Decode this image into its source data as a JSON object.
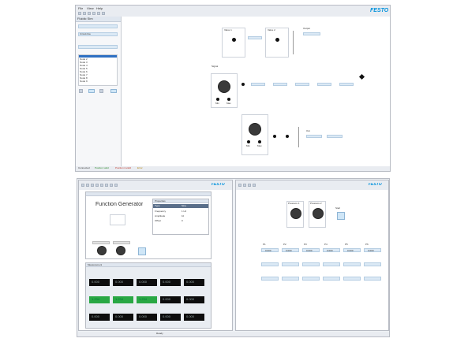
{
  "app": {
    "brand": "FESTO",
    "menu": [
      "File",
      "View",
      "Help"
    ]
  },
  "sidebar": {
    "header": "Fluidic Sim",
    "field_value": "Circuit.fsw",
    "list_items": [
      "Node 1",
      "Node 2",
      "Node 3",
      "Node 4",
      "Node 5",
      "Node 6",
      "Node 7",
      "Node 8",
      "Node 9"
    ],
    "selected_index": 0
  },
  "canvas_top": {
    "block_labels": [
      "Valve 1",
      "Valve 2",
      "Signal",
      "Output",
      "Input",
      "Input",
      "Out",
      "Out"
    ],
    "knob_labels": [
      "Min",
      "Max"
    ]
  },
  "status_bar": {
    "items": [
      "Connected",
      "Position valid",
      "Position invalid",
      "Error"
    ]
  },
  "window_fg": {
    "title": "Function Generator",
    "prop_title": "Properties",
    "props": [
      {
        "key": "Type",
        "value": "Sine"
      },
      {
        "key": "Frequency",
        "value": "1 Hz"
      },
      {
        "key": "Amplitude",
        "value": "10"
      },
      {
        "key": "Offset",
        "value": "0"
      }
    ],
    "knob_labels": [
      "A",
      "B"
    ]
  },
  "lcd_window": {
    "title": "Measurement",
    "readouts": [
      "0.000",
      "0.000",
      "0.000",
      "0.000",
      "0.000",
      "1.234",
      "1.234",
      "1.234",
      "0.000",
      "0.000",
      "0.000",
      "0.000",
      "0.000",
      "0.000",
      "0.000"
    ]
  },
  "right_window": {
    "brand": "FESTO",
    "knob_labels": [
      "Pressure 1",
      "Pressure 2"
    ],
    "button_label": "Start",
    "table_headers": [
      "P1",
      "P2",
      "P3",
      "P4",
      "P5",
      "P6"
    ],
    "table_values": [
      "0.000",
      "0.000",
      "0.000",
      "0.000",
      "0.000",
      "0.000"
    ]
  },
  "bottom_status": {
    "text": "Ready"
  },
  "colors": {
    "accent": "#0091dc",
    "button": "#cfe6f7",
    "lcd_green": "#29a844",
    "lcd_black": "#0d0d0d"
  }
}
